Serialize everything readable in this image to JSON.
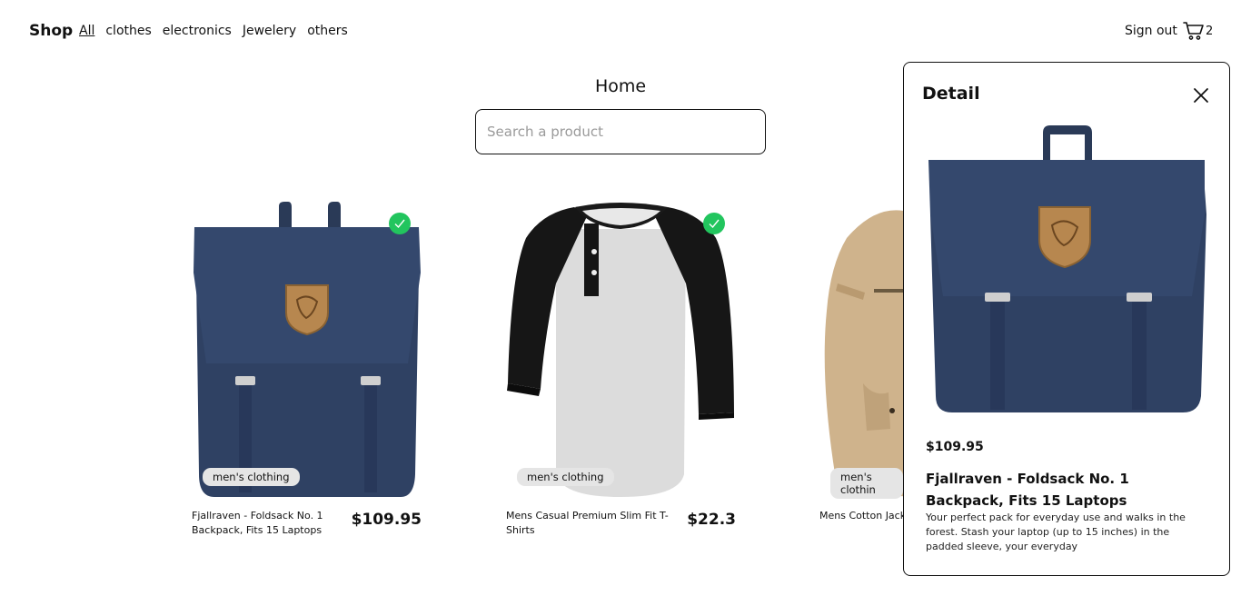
{
  "nav": {
    "brand": "Shop",
    "links": [
      {
        "label": "All",
        "active": true
      },
      {
        "label": "clothes",
        "active": false
      },
      {
        "label": "electronics",
        "active": false
      },
      {
        "label": "Jewelery",
        "active": false
      },
      {
        "label": "others",
        "active": false
      }
    ],
    "signout": "Sign out",
    "cart_icon": "cart-icon",
    "cart_count": "2"
  },
  "page": {
    "title": "Home",
    "search_placeholder": "Search a product"
  },
  "products": [
    {
      "name": "Fjallraven - Foldsack No. 1 Backpack, Fits 15 Laptops",
      "price": "$109.95",
      "category": "men's clothing",
      "in_cart": true,
      "image": "backpack"
    },
    {
      "name": "Mens Casual Premium Slim Fit T-Shirts",
      "price": "$22.3",
      "category": "men's clothing",
      "in_cart": true,
      "image": "t-shirt"
    },
    {
      "name": "Mens Cotton Jack",
      "price": "",
      "category": "men's clothin",
      "in_cart": false,
      "image": "jacket"
    }
  ],
  "detail": {
    "title": "Detail",
    "close_icon": "close-icon",
    "price": "$109.95",
    "name": "Fjallraven - Foldsack No. 1 Backpack, Fits 15 Laptops",
    "description": "Your perfect pack for everyday use and walks in the forest. Stash your laptop (up to 15 inches) in the padded sleeve, your everyday",
    "image": "backpack"
  },
  "colors": {
    "check_green": "#22c55e",
    "badge_bg": "#e5e5e5",
    "backpack_navy": "#2c3e5e"
  }
}
